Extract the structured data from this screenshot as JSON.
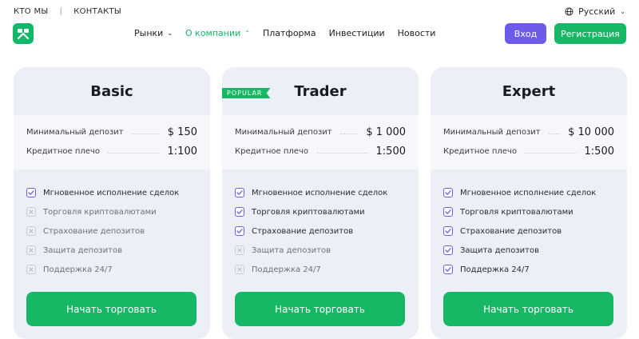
{
  "topbar": {
    "links": [
      "КТО МЫ",
      "КОНТАКТЫ"
    ],
    "separator": "|",
    "language": "Русский"
  },
  "header": {
    "logo_icon": "logo-icon",
    "nav": [
      {
        "label": "Рынки",
        "chevron": "chevron-down-icon",
        "active": false
      },
      {
        "label": "О компании",
        "chevron": "chevron-up-icon",
        "active": true
      },
      {
        "label": "Платформа",
        "chevron": null,
        "active": false
      },
      {
        "label": "Инвестиции",
        "chevron": null,
        "active": false
      },
      {
        "label": "Новости",
        "chevron": null,
        "active": false
      }
    ],
    "login": "Вход",
    "register": "Регистрация"
  },
  "colors": {
    "accent_green": "#16b765",
    "accent_purple": "#6c5ce7",
    "card_bg": "#eceff6"
  },
  "plans": [
    {
      "name": "Basic",
      "badge": "",
      "min_deposit_label": "Минимальный депозит",
      "min_deposit": "$ 150",
      "leverage_label": "Кредитное плечо",
      "leverage": "1:100",
      "features": [
        {
          "label": "Мгновенное исполнение сделок",
          "enabled": true
        },
        {
          "label": "Торговля криптовалютами",
          "enabled": false
        },
        {
          "label": "Страхование депозитов",
          "enabled": false
        },
        {
          "label": "Защита депозитов",
          "enabled": false
        },
        {
          "label": "Поддержка 24/7",
          "enabled": false
        }
      ],
      "cta": "Начать торговать"
    },
    {
      "name": "Trader",
      "badge": "POPULAR",
      "min_deposit_label": "Минимальный депозит",
      "min_deposit": "$ 1 000",
      "leverage_label": "Кредитное плечо",
      "leverage": "1:500",
      "features": [
        {
          "label": "Мгновенное исполнение сделок",
          "enabled": true
        },
        {
          "label": "Торговля криптовалютами",
          "enabled": true
        },
        {
          "label": "Страхование депозитов",
          "enabled": true
        },
        {
          "label": "Защита депозитов",
          "enabled": false
        },
        {
          "label": "Поддержка 24/7",
          "enabled": false
        }
      ],
      "cta": "Начать торговать"
    },
    {
      "name": "Expert",
      "badge": "",
      "min_deposit_label": "Минимальный депозит",
      "min_deposit": "$ 10 000",
      "leverage_label": "Кредитное плечо",
      "leverage": "1:500",
      "features": [
        {
          "label": "Мгновенное исполнение сделок",
          "enabled": true
        },
        {
          "label": "Торговля криптовалютами",
          "enabled": true
        },
        {
          "label": "Страхование депозитов",
          "enabled": true
        },
        {
          "label": "Защита депозитов",
          "enabled": true
        },
        {
          "label": "Поддержка 24/7",
          "enabled": true
        }
      ],
      "cta": "Начать торговать"
    }
  ]
}
